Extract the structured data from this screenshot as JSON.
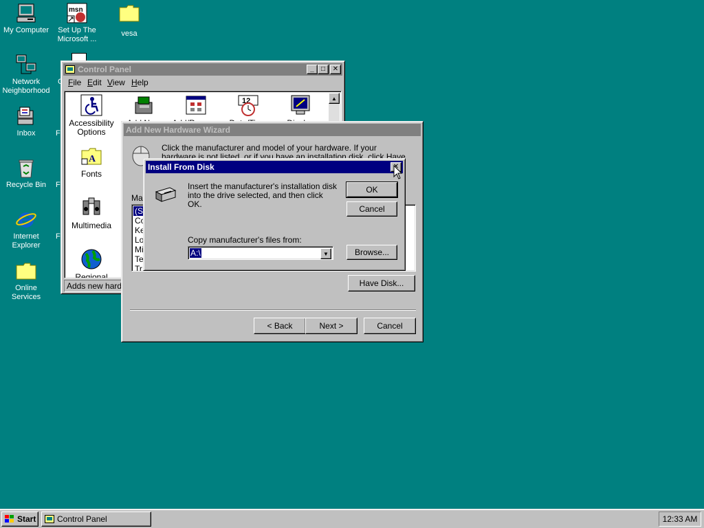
{
  "desktop": {
    "icons": [
      {
        "label": "My Computer"
      },
      {
        "label": "Set Up The Microsoft ..."
      },
      {
        "label": "vesa"
      },
      {
        "label": "Network Neighborhood"
      },
      {
        "label": "Inbox"
      },
      {
        "label": "Recycle Bin"
      },
      {
        "label": "Internet Explorer"
      },
      {
        "label": "Online Services"
      }
    ],
    "partial_labels": [
      "F",
      "F",
      "F",
      "C"
    ]
  },
  "control_panel": {
    "title": "Control Panel",
    "menu": [
      "File",
      "Edit",
      "View",
      "Help"
    ],
    "items": [
      {
        "label": "Accessibility Options"
      },
      {
        "label": "Add New"
      },
      {
        "label": "Add/Remove"
      },
      {
        "label": "Date/Time"
      },
      {
        "label": "Display"
      },
      {
        "label": "Fonts"
      },
      {
        "label": "Multimedia"
      },
      {
        "label": "Regional"
      }
    ],
    "status": "Adds new hardw"
  },
  "wizard": {
    "title": "Add New Hardware Wizard",
    "instruction": "Click the manufacturer and model of your hardware. If your hardware is not listed, or if you have an installation disk, click Have Disk.",
    "manufacturers_label": "Mar",
    "manufacturers": [
      "(St",
      "Cor",
      "Ker",
      "Log",
      "Mic",
      "Tes",
      "Tr"
    ],
    "have_disk": "Have Disk...",
    "back": "< Back",
    "next": "Next >",
    "cancel": "Cancel"
  },
  "install_dialog": {
    "title": "Install From Disk",
    "message": "Insert the manufacturer's installation disk into the drive selected, and then click OK.",
    "ok": "OK",
    "cancel": "Cancel",
    "copy_label": "Copy manufacturer's files from:",
    "path_value": "A:\\",
    "browse": "Browse..."
  },
  "taskbar": {
    "start": "Start",
    "task": "Control Panel",
    "clock": "12:33 AM"
  },
  "colors": {
    "desktop": "#008080",
    "face": "#c0c0c0",
    "active_title": "#000080",
    "inactive_title": "#808080"
  }
}
